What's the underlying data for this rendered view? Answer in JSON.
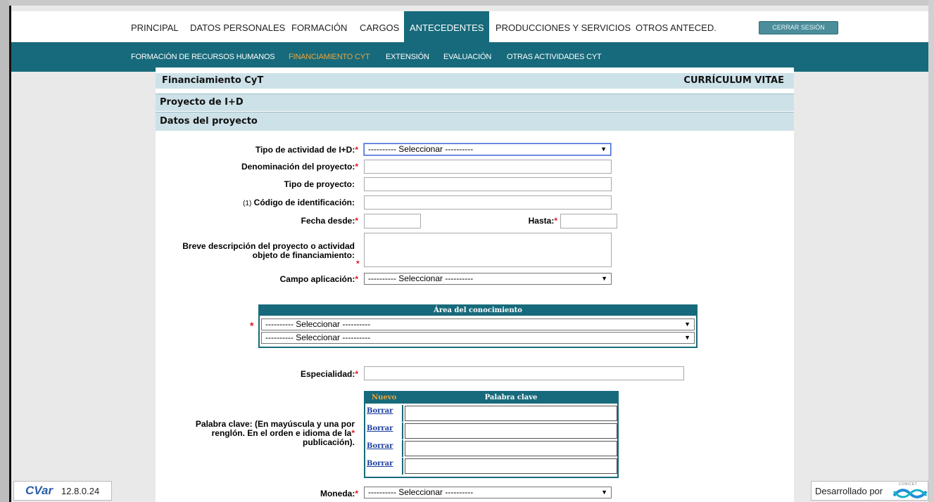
{
  "nav": {
    "items": [
      "PRINCIPAL",
      "DATOS PERSONALES",
      "FORMACIÓN",
      "CARGOS",
      "ANTECEDENTES",
      "PRODUCCIONES Y SERVICIOS",
      "OTROS ANTECED."
    ],
    "active": "ANTECEDENTES",
    "logout_label": "CERRAR SESIÓN"
  },
  "subnav": {
    "items": [
      "FORMACIÓN DE RECURSOS HUMANOS",
      "FINANCIAMIENTO CYT",
      "EXTENSIÓN",
      "EVALUACIÓN",
      "OTRAS ACTIVIDADES CYT"
    ],
    "active": "FINANCIAMIENTO CYT"
  },
  "header": {
    "title": "Financiamiento CyT",
    "right": "CURRÍCULUM VITAE"
  },
  "sections": {
    "project": "Proyecto de I+D",
    "data": "Datos del proyecto"
  },
  "form": {
    "tipo_actividad_label": "Tipo de actividad de I+D:",
    "denominacion_label": "Denominación del proyecto:",
    "tipo_proyecto_label": "Tipo de proyecto:",
    "codigo_note": "(1)",
    "codigo_label": "Código de identificación:",
    "fecha_desde_label": "Fecha desde:",
    "hasta_label": "Hasta:",
    "descripcion_label_1": "Breve descripción del proyecto o actividad",
    "descripcion_label_2": "objeto de financiamiento:",
    "campo_label": "Campo aplicación:",
    "area_title": "Área del conocimiento",
    "especialidad_label": "Especialidad:",
    "palabra_label_1": "Palabra clave: (En mayúscula y una por",
    "palabra_label_2": "renglón. En el orden e idioma de la",
    "palabra_label_3": "publicación).",
    "kw_new": "Nuevo",
    "kw_col": "Palabra clave",
    "kw_delete": "Borrar",
    "moneda_label": "Moneda:",
    "select_placeholder": "---------- Seleccionar ----------",
    "required_mark": "*"
  },
  "footer": {
    "brand": "CVar",
    "version": "12.8.0.24",
    "dev_text": "Desarrollado por",
    "org": "CONICET"
  },
  "colors": {
    "teal": "#176a7b",
    "accent": "#f0a43a",
    "header_bg": "#cde2e8",
    "required": "#e0161f"
  }
}
